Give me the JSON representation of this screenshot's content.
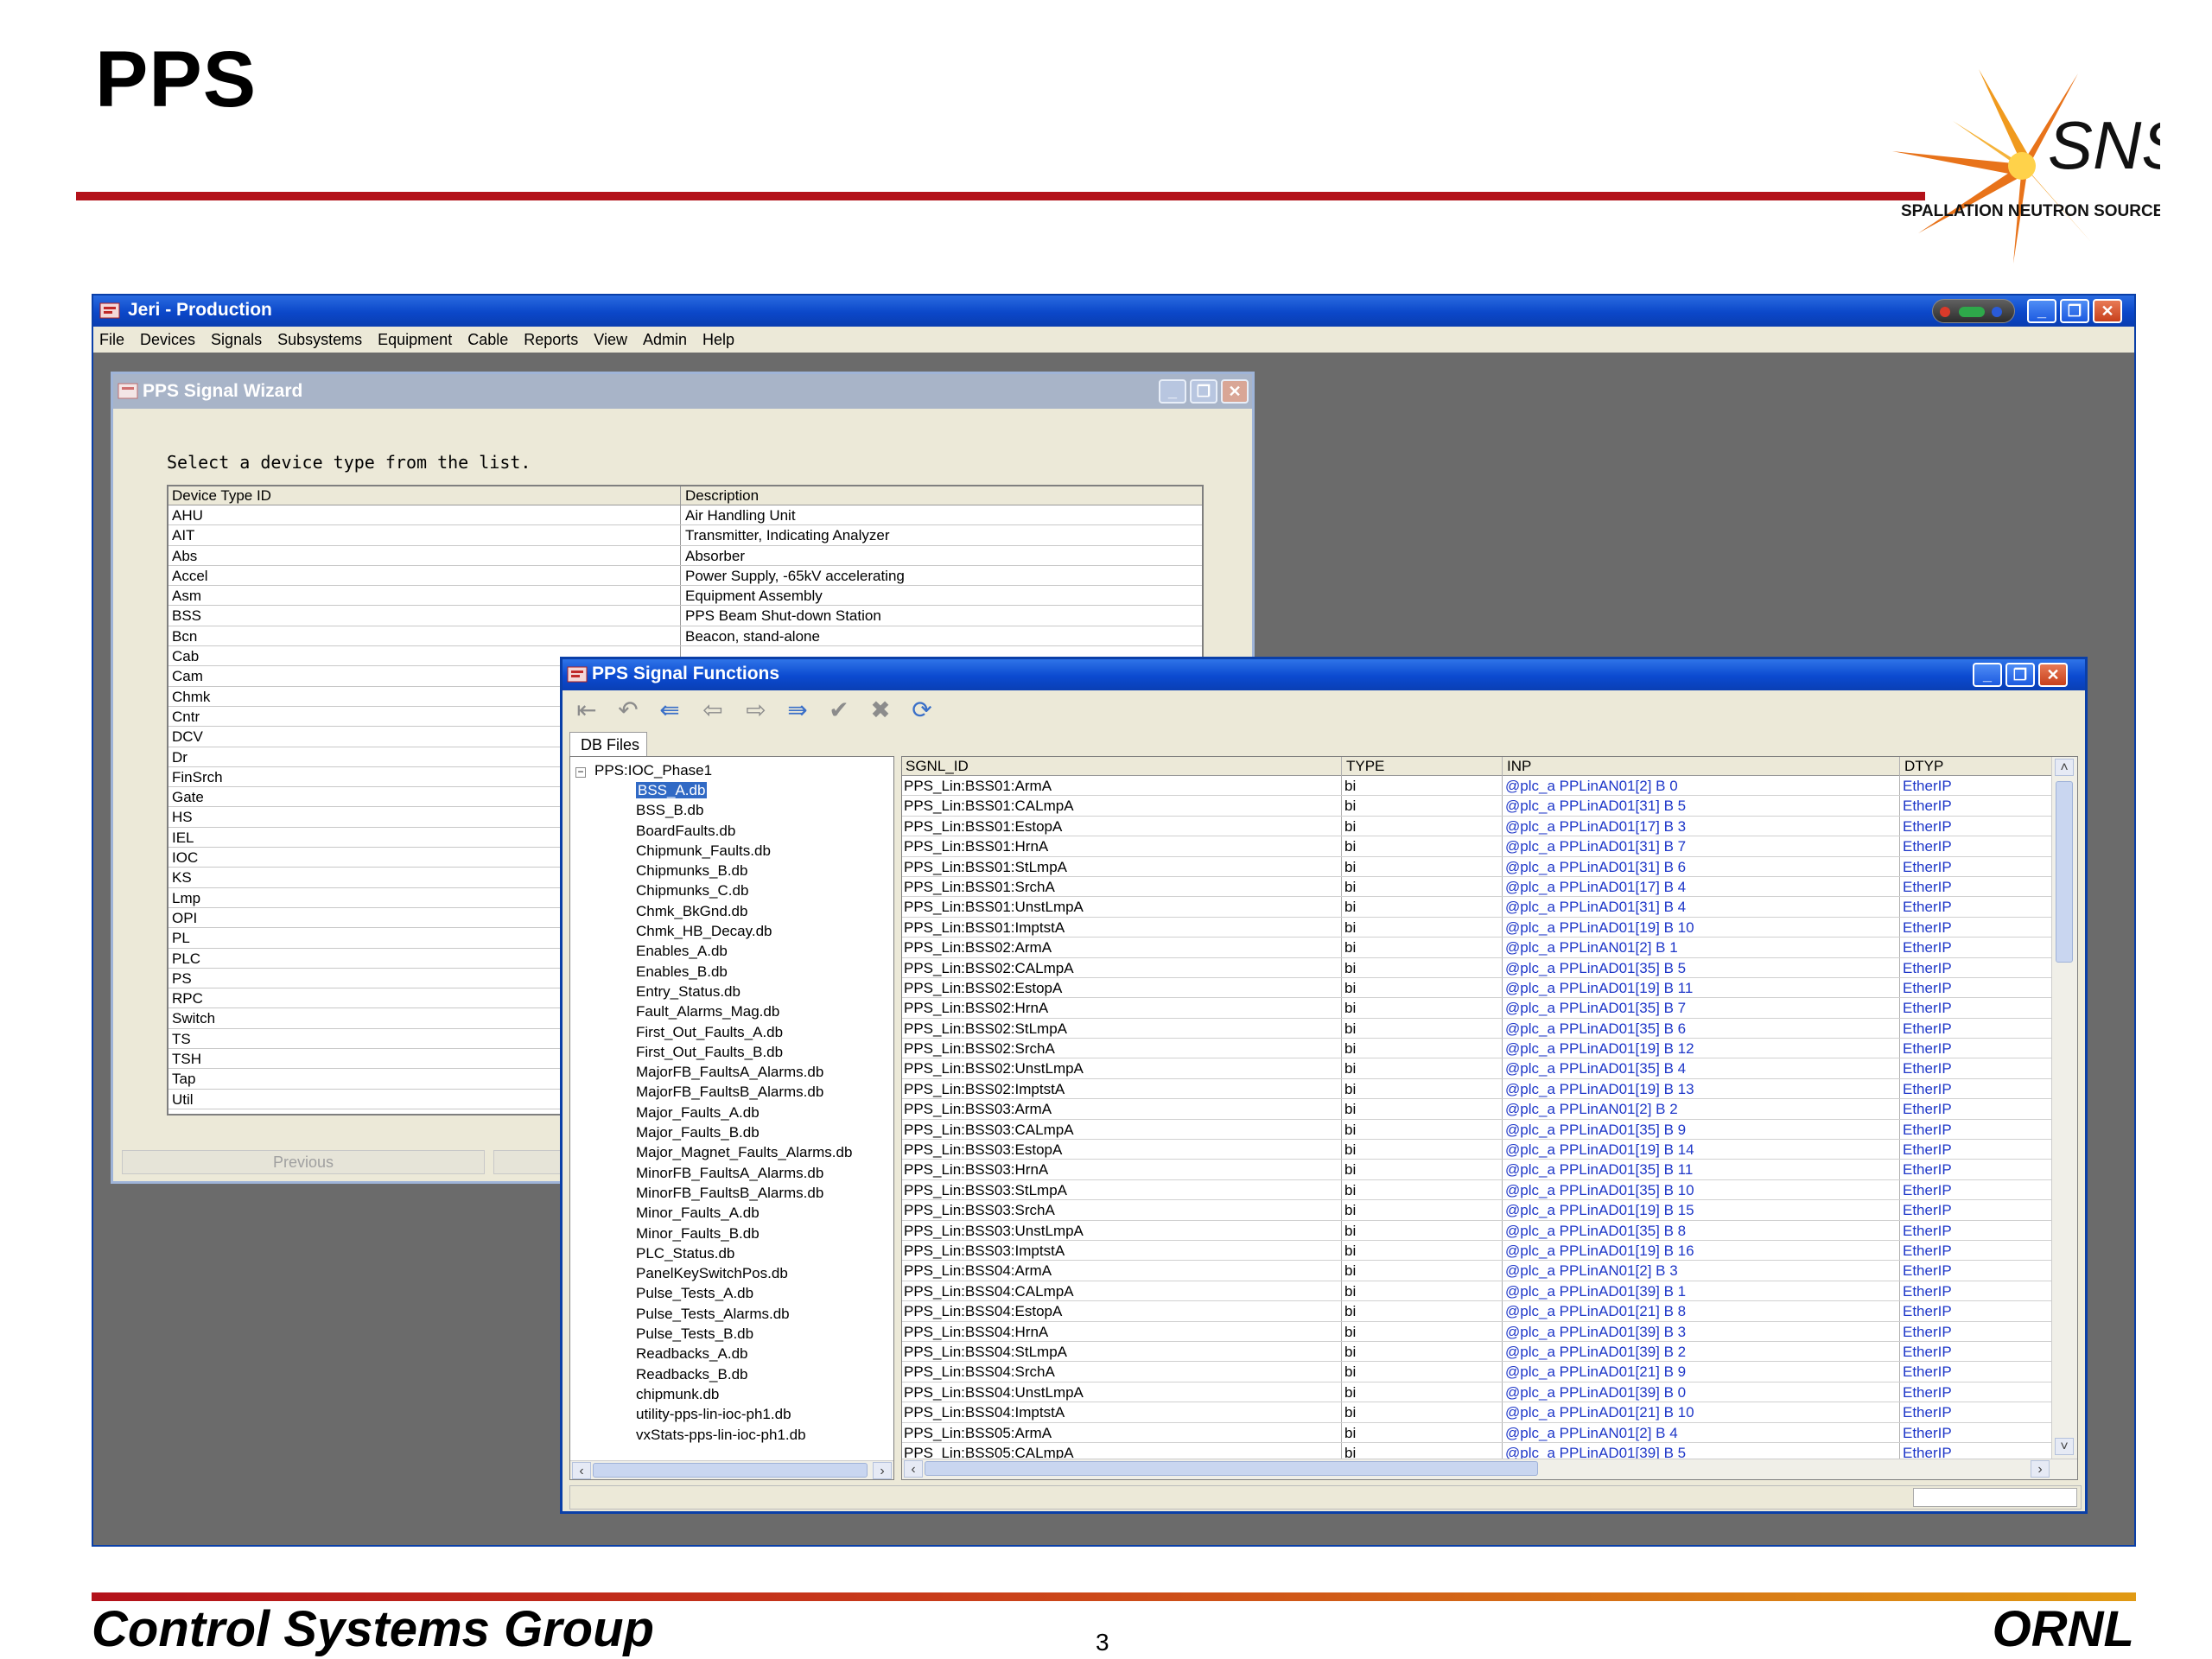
{
  "slide": {
    "title": "PPS",
    "footer_left": "Control Systems Group",
    "footer_right": "ORNL",
    "page_number": "3",
    "logo": {
      "text_main": "SNS",
      "text_sub": "SPALLATION NEUTRON SOURCE"
    }
  },
  "app": {
    "title": "Jeri - Production",
    "menu": [
      "File",
      "Devices",
      "Signals",
      "Subsystems",
      "Equipment",
      "Cable",
      "Reports",
      "View",
      "Admin",
      "Help"
    ],
    "window_buttons": {
      "minimize": "_",
      "restore": "❐",
      "close": "✕"
    }
  },
  "wizard": {
    "title": "PPS Signal Wizard",
    "prompt": "Select a device type from the list.",
    "columns": {
      "id": "Device Type ID",
      "description": "Description"
    },
    "rows": [
      {
        "id": "AHU",
        "description": "Air Handling Unit"
      },
      {
        "id": "AIT",
        "description": "Transmitter, Indicating Analyzer"
      },
      {
        "id": "Abs",
        "description": "Absorber"
      },
      {
        "id": "Accel",
        "description": "Power Supply, -65kV accelerating"
      },
      {
        "id": "Asm",
        "description": "Equipment Assembly"
      },
      {
        "id": "BSS",
        "description": "PPS Beam Shut-down Station"
      },
      {
        "id": "Bcn",
        "description": "Beacon, stand-alone"
      },
      {
        "id": "Cab",
        "description": ""
      },
      {
        "id": "Cam",
        "description": ""
      },
      {
        "id": "Chmk",
        "description": ""
      },
      {
        "id": "Cntr",
        "description": ""
      },
      {
        "id": "DCV",
        "description": ""
      },
      {
        "id": "Dr",
        "description": ""
      },
      {
        "id": "FinSrch",
        "description": ""
      },
      {
        "id": "Gate",
        "description": ""
      },
      {
        "id": "HS",
        "description": ""
      },
      {
        "id": "IEL",
        "description": ""
      },
      {
        "id": "IOC",
        "description": ""
      },
      {
        "id": "KS",
        "description": ""
      },
      {
        "id": "Lmp",
        "description": ""
      },
      {
        "id": "OPI",
        "description": ""
      },
      {
        "id": "PL",
        "description": ""
      },
      {
        "id": "PLC",
        "description": ""
      },
      {
        "id": "PS",
        "description": ""
      },
      {
        "id": "RPC",
        "description": ""
      },
      {
        "id": "Switch",
        "description": ""
      },
      {
        "id": "TS",
        "description": ""
      },
      {
        "id": "TSH",
        "description": ""
      },
      {
        "id": "Tap",
        "description": ""
      },
      {
        "id": "Util",
        "description": ""
      }
    ],
    "previous_label": "Previous"
  },
  "functions": {
    "title": "PPS Signal Functions",
    "tab_label": "DB Files",
    "tree": {
      "root": "PPS:IOC_Phase1",
      "selected": "BSS_A.db",
      "items": [
        "BSS_A.db",
        "BSS_B.db",
        "BoardFaults.db",
        "Chipmunk_Faults.db",
        "Chipmunks_B.db",
        "Chipmunks_C.db",
        "Chmk_BkGnd.db",
        "Chmk_HB_Decay.db",
        "Enables_A.db",
        "Enables_B.db",
        "Entry_Status.db",
        "Fault_Alarms_Mag.db",
        "First_Out_Faults_A.db",
        "First_Out_Faults_B.db",
        "MajorFB_FaultsA_Alarms.db",
        "MajorFB_FaultsB_Alarms.db",
        "Major_Faults_A.db",
        "Major_Faults_B.db",
        "Major_Magnet_Faults_Alarms.db",
        "MinorFB_FaultsA_Alarms.db",
        "MinorFB_FaultsB_Alarms.db",
        "Minor_Faults_A.db",
        "Minor_Faults_B.db",
        "PLC_Status.db",
        "PanelKeySwitchPos.db",
        "Pulse_Tests_A.db",
        "Pulse_Tests_Alarms.db",
        "Pulse_Tests_B.db",
        "Readbacks_A.db",
        "Readbacks_B.db",
        "chipmunk.db",
        "utility-pps-lin-ioc-ph1.db",
        "vxStats-pps-lin-ioc-ph1.db"
      ]
    },
    "grid": {
      "columns": {
        "sgnl_id": "SGNL_ID",
        "type": "TYPE",
        "inp": "INP",
        "dtyp": "DTYP"
      },
      "rows": [
        {
          "sgnl_id": "PPS_Lin:BSS01:ArmA",
          "type": "bi",
          "inp": "@plc_a PPLinAN01[2] B 0",
          "dtyp": "EtherIP"
        },
        {
          "sgnl_id": "PPS_Lin:BSS01:CALmpA",
          "type": "bi",
          "inp": "@plc_a PPLinAD01[31] B 5",
          "dtyp": "EtherIP"
        },
        {
          "sgnl_id": "PPS_Lin:BSS01:EstopA",
          "type": "bi",
          "inp": "@plc_a PPLinAD01[17] B 3",
          "dtyp": "EtherIP"
        },
        {
          "sgnl_id": "PPS_Lin:BSS01:HrnA",
          "type": "bi",
          "inp": "@plc_a PPLinAD01[31] B 7",
          "dtyp": "EtherIP"
        },
        {
          "sgnl_id": "PPS_Lin:BSS01:StLmpA",
          "type": "bi",
          "inp": "@plc_a PPLinAD01[31] B 6",
          "dtyp": "EtherIP"
        },
        {
          "sgnl_id": "PPS_Lin:BSS01:SrchA",
          "type": "bi",
          "inp": "@plc_a PPLinAD01[17] B 4",
          "dtyp": "EtherIP"
        },
        {
          "sgnl_id": "PPS_Lin:BSS01:UnstLmpA",
          "type": "bi",
          "inp": "@plc_a PPLinAD01[31] B 4",
          "dtyp": "EtherIP"
        },
        {
          "sgnl_id": "PPS_Lin:BSS01:ImptstA",
          "type": "bi",
          "inp": "@plc_a PPLinAD01[19] B 10",
          "dtyp": "EtherIP"
        },
        {
          "sgnl_id": "PPS_Lin:BSS02:ArmA",
          "type": "bi",
          "inp": "@plc_a PPLinAN01[2] B 1",
          "dtyp": "EtherIP"
        },
        {
          "sgnl_id": "PPS_Lin:BSS02:CALmpA",
          "type": "bi",
          "inp": "@plc_a PPLinAD01[35] B 5",
          "dtyp": "EtherIP"
        },
        {
          "sgnl_id": "PPS_Lin:BSS02:EstopA",
          "type": "bi",
          "inp": "@plc_a PPLinAD01[19] B 11",
          "dtyp": "EtherIP"
        },
        {
          "sgnl_id": "PPS_Lin:BSS02:HrnA",
          "type": "bi",
          "inp": "@plc_a PPLinAD01[35] B 7",
          "dtyp": "EtherIP"
        },
        {
          "sgnl_id": "PPS_Lin:BSS02:StLmpA",
          "type": "bi",
          "inp": "@plc_a PPLinAD01[35] B 6",
          "dtyp": "EtherIP"
        },
        {
          "sgnl_id": "PPS_Lin:BSS02:SrchA",
          "type": "bi",
          "inp": "@plc_a PPLinAD01[19] B 12",
          "dtyp": "EtherIP"
        },
        {
          "sgnl_id": "PPS_Lin:BSS02:UnstLmpA",
          "type": "bi",
          "inp": "@plc_a PPLinAD01[35] B 4",
          "dtyp": "EtherIP"
        },
        {
          "sgnl_id": "PPS_Lin:BSS02:ImptstA",
          "type": "bi",
          "inp": "@plc_a PPLinAD01[19] B 13",
          "dtyp": "EtherIP"
        },
        {
          "sgnl_id": "PPS_Lin:BSS03:ArmA",
          "type": "bi",
          "inp": "@plc_a PPLinAN01[2] B 2",
          "dtyp": "EtherIP"
        },
        {
          "sgnl_id": "PPS_Lin:BSS03:CALmpA",
          "type": "bi",
          "inp": "@plc_a PPLinAD01[35] B 9",
          "dtyp": "EtherIP"
        },
        {
          "sgnl_id": "PPS_Lin:BSS03:EstopA",
          "type": "bi",
          "inp": "@plc_a PPLinAD01[19] B 14",
          "dtyp": "EtherIP"
        },
        {
          "sgnl_id": "PPS_Lin:BSS03:HrnA",
          "type": "bi",
          "inp": "@plc_a PPLinAD01[35] B 11",
          "dtyp": "EtherIP"
        },
        {
          "sgnl_id": "PPS_Lin:BSS03:StLmpA",
          "type": "bi",
          "inp": "@plc_a PPLinAD01[35] B 10",
          "dtyp": "EtherIP"
        },
        {
          "sgnl_id": "PPS_Lin:BSS03:SrchA",
          "type": "bi",
          "inp": "@plc_a PPLinAD01[19] B 15",
          "dtyp": "EtherIP"
        },
        {
          "sgnl_id": "PPS_Lin:BSS03:UnstLmpA",
          "type": "bi",
          "inp": "@plc_a PPLinAD01[35] B 8",
          "dtyp": "EtherIP"
        },
        {
          "sgnl_id": "PPS_Lin:BSS03:ImptstA",
          "type": "bi",
          "inp": "@plc_a PPLinAD01[19] B 16",
          "dtyp": "EtherIP"
        },
        {
          "sgnl_id": "PPS_Lin:BSS04:ArmA",
          "type": "bi",
          "inp": "@plc_a PPLinAN01[2] B 3",
          "dtyp": "EtherIP"
        },
        {
          "sgnl_id": "PPS_Lin:BSS04:CALmpA",
          "type": "bi",
          "inp": "@plc_a PPLinAD01[39] B 1",
          "dtyp": "EtherIP"
        },
        {
          "sgnl_id": "PPS_Lin:BSS04:EstopA",
          "type": "bi",
          "inp": "@plc_a PPLinAD01[21] B 8",
          "dtyp": "EtherIP"
        },
        {
          "sgnl_id": "PPS_Lin:BSS04:HrnA",
          "type": "bi",
          "inp": "@plc_a PPLinAD01[39] B 3",
          "dtyp": "EtherIP"
        },
        {
          "sgnl_id": "PPS_Lin:BSS04:StLmpA",
          "type": "bi",
          "inp": "@plc_a PPLinAD01[39] B 2",
          "dtyp": "EtherIP"
        },
        {
          "sgnl_id": "PPS_Lin:BSS04:SrchA",
          "type": "bi",
          "inp": "@plc_a PPLinAD01[21] B 9",
          "dtyp": "EtherIP"
        },
        {
          "sgnl_id": "PPS_Lin:BSS04:UnstLmpA",
          "type": "bi",
          "inp": "@plc_a PPLinAD01[39] B 0",
          "dtyp": "EtherIP"
        },
        {
          "sgnl_id": "PPS_Lin:BSS04:ImptstA",
          "type": "bi",
          "inp": "@plc_a PPLinAD01[21] B 10",
          "dtyp": "EtherIP"
        },
        {
          "sgnl_id": "PPS_Lin:BSS05:ArmA",
          "type": "bi",
          "inp": "@plc_a PPLinAN01[2] B 4",
          "dtyp": "EtherIP"
        },
        {
          "sgnl_id": "PPS_Lin:BSS05:CALmpA",
          "type": "bi",
          "inp": "@plc_a PPLinAD01[39] B 5",
          "dtyp": "EtherIP"
        }
      ]
    },
    "toolbar_icons": [
      "exit-icon",
      "undo-icon",
      "first-icon",
      "previous-icon",
      "next-icon",
      "last-icon",
      "commit-icon",
      "cancel-icon",
      "refresh-icon"
    ]
  },
  "colors": {
    "xp_title_blue": "#0b47c9",
    "slide_red": "#b3121a",
    "link_blue": "#1d36c8",
    "desktop_gray": "#6b6b6b"
  }
}
